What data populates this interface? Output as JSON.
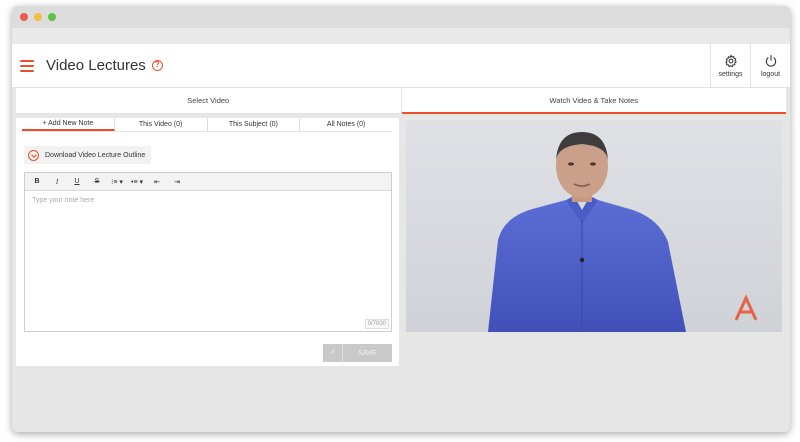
{
  "window_controls": {
    "close_color": "#ef5a4f",
    "minimize_color": "#f6bd3f",
    "maximize_color": "#5dc243"
  },
  "header": {
    "title": "Video Lectures",
    "help": "?",
    "settings_label": "settings",
    "logout_label": "logout",
    "accent": "#e8502b"
  },
  "tabs": [
    {
      "label": "Select Video",
      "active": false
    },
    {
      "label": "Watch Video & Take Notes",
      "active": true
    }
  ],
  "notes": {
    "subtabs": [
      "+ Add New Note",
      "This Video (0)",
      "This Subject (0)",
      "All Notes (0)"
    ],
    "download_label": "Download Video Lecture Outline",
    "toolbar": {
      "bold": "B",
      "italic": "I",
      "underline": "U",
      "strike": "S",
      "ordered_list": "⁝≡ ▾",
      "bullet_list": "•≡ ▾",
      "outdent": "⇤",
      "indent": "⇥"
    },
    "placeholder": "Type your note here",
    "counter": "0/7000",
    "save_label": "SAVE",
    "save_check": "✓"
  }
}
